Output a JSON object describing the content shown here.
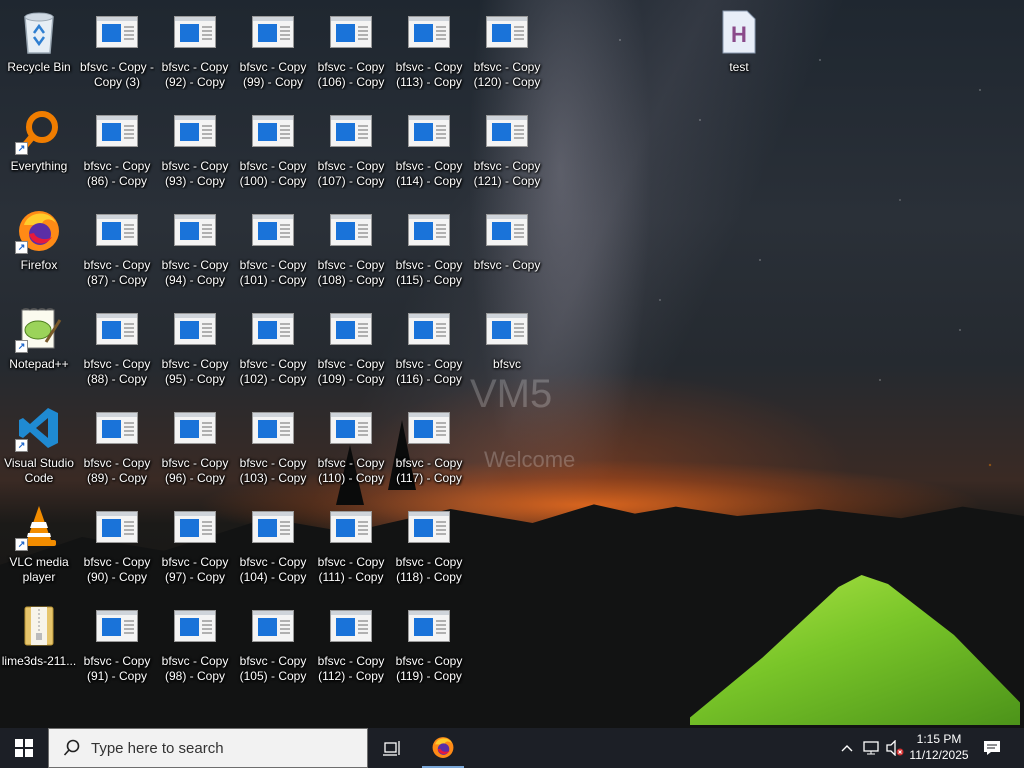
{
  "desktop": {
    "watermark": {
      "machine": "VM5",
      "greeting": "Welcome"
    },
    "icons": {
      "recycle_bin": "Recycle Bin",
      "everything": "Everything",
      "firefox": "Firefox",
      "notepadpp": "Notepad++",
      "vscode": "Visual Studio Code",
      "vlc": "VLC media player",
      "lime3ds": "lime3ds-211...",
      "test": "test",
      "c1": [
        "bfsvc - Copy - Copy (3)",
        "bfsvc - Copy (86) - Copy",
        "bfsvc - Copy (87) - Copy",
        "bfsvc - Copy (88) - Copy",
        "bfsvc - Copy (89) - Copy",
        "bfsvc - Copy (90) - Copy",
        "bfsvc - Copy (91) - Copy"
      ],
      "c2": [
        "bfsvc - Copy (92) - Copy",
        "bfsvc - Copy (93) - Copy",
        "bfsvc - Copy (94) - Copy",
        "bfsvc - Copy (95) - Copy",
        "bfsvc - Copy (96) - Copy",
        "bfsvc - Copy (97) - Copy",
        "bfsvc - Copy (98) - Copy"
      ],
      "c3": [
        "bfsvc - Copy (99) - Copy",
        "bfsvc - Copy (100) - Copy",
        "bfsvc - Copy (101) - Copy",
        "bfsvc - Copy (102) - Copy",
        "bfsvc - Copy (103) - Copy",
        "bfsvc - Copy (104) - Copy",
        "bfsvc - Copy (105) - Copy"
      ],
      "c4": [
        "bfsvc - Copy (106) - Copy",
        "bfsvc - Copy (107) - Copy",
        "bfsvc - Copy (108) - Copy",
        "bfsvc - Copy (109) - Copy",
        "bfsvc - Copy (110) - Copy",
        "bfsvc - Copy (111) - Copy",
        "bfsvc - Copy (112) - Copy"
      ],
      "c5": [
        "bfsvc - Copy (113) - Copy",
        "bfsvc - Copy (114) - Copy",
        "bfsvc - Copy (115) - Copy",
        "bfsvc - Copy (116) - Copy",
        "bfsvc - Copy (117) - Copy",
        "bfsvc - Copy (118) - Copy",
        "bfsvc - Copy (119) - Copy"
      ],
      "c6": [
        "bfsvc - Copy (120) - Copy",
        "bfsvc - Copy (121) - Copy",
        "bfsvc - Copy",
        "bfsvc"
      ]
    }
  },
  "taskbar": {
    "start_icon": "windows-logo-icon",
    "search_placeholder": "Type here to search",
    "task_view_icon": "task-view-icon",
    "pinned": [
      "firefox-icon"
    ],
    "tray_icons": [
      "chevron-up-icon",
      "network-icon",
      "speaker-muted-icon"
    ],
    "time": "1:15 PM",
    "date": "11/12/2025",
    "notification_icon": "notification-icon"
  },
  "colors": {
    "taskbar": "#1c1f26",
    "exe_blue": "#1a73d9",
    "tent": "#8fd92f"
  }
}
